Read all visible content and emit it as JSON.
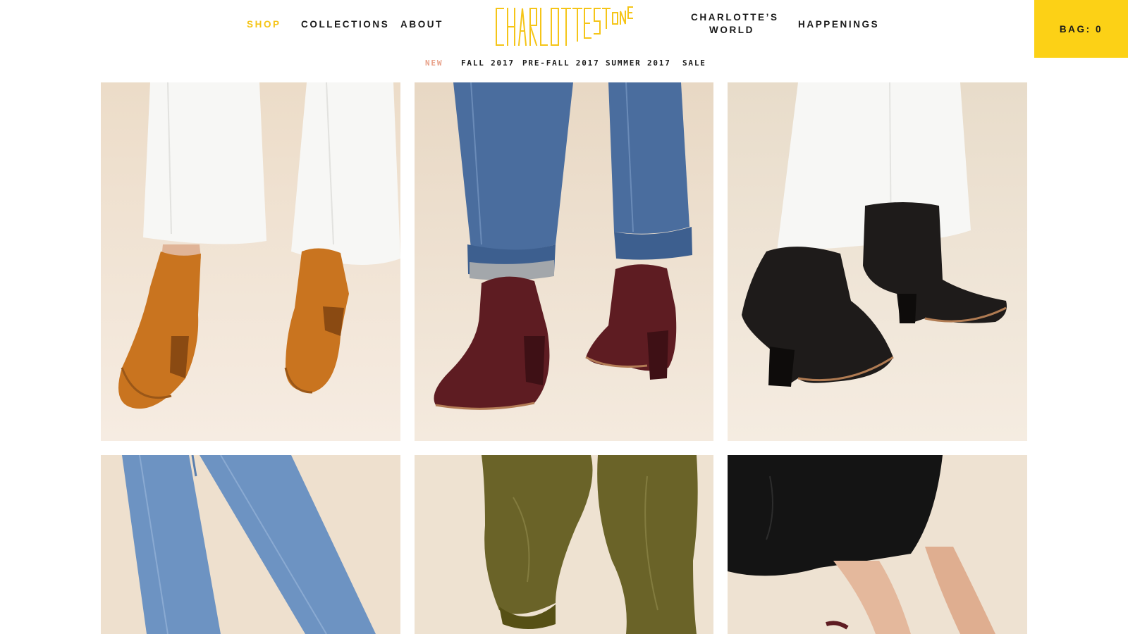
{
  "brand": {
    "logo_text": "CHARLOTTESTONE"
  },
  "nav": {
    "shop": "SHOP",
    "collections": "COLLECTIONS",
    "about": "ABOUT",
    "world_line1": "CHARLOTTE’S",
    "world_line2": "WORLD",
    "happenings": "HAPPENINGS"
  },
  "bag": {
    "label": "BAG: 0"
  },
  "subnav": {
    "items": [
      "NEW",
      "FALL 2017",
      "PRE-FALL 2017",
      "SUMMER 2017",
      "SALE"
    ],
    "active": "NEW"
  },
  "colors": {
    "accent_yellow": "#fcd116",
    "active_nav": "#f5c518",
    "active_subnav": "#e8a088",
    "tile_background": "#efe3d3"
  },
  "products": [
    {
      "depicts": "tan ankle boots with white cropped jeans",
      "boot_color": "#c9741f",
      "pant_color": "#f6f6f4"
    },
    {
      "depicts": "burgundy ankle boots with cuffed blue jeans",
      "boot_color": "#5e1c22",
      "pant_color": "#4a6d9e"
    },
    {
      "depicts": "black ankle boots with white jeans",
      "boot_color": "#1e1b1a",
      "pant_color": "#f6f6f4"
    },
    {
      "depicts": "light blue frayed jeans",
      "pant_color": "#6d93c2"
    },
    {
      "depicts": "olive green trousers",
      "pant_color": "#6a6328"
    },
    {
      "depicts": "black dress",
      "pant_color": "#141414"
    }
  ]
}
